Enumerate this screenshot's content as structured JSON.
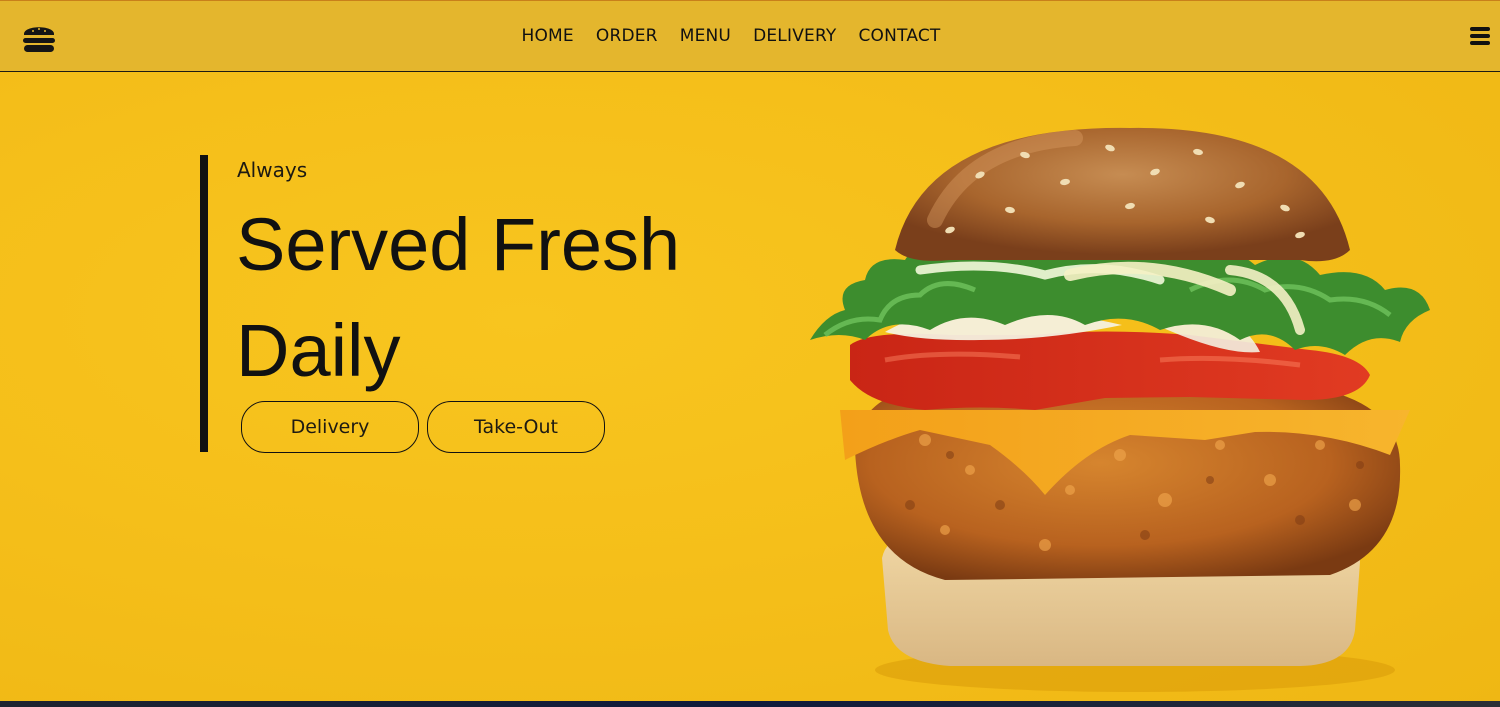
{
  "header": {
    "logo_icon": "burger-icon",
    "nav": [
      "HOME",
      "ORDER",
      "MENU",
      "DELIVERY",
      "CONTACT"
    ],
    "menu_icon": "hamburger-menu-icon"
  },
  "hero": {
    "kicker": "Always",
    "headline_line1": "Served Fresh",
    "headline_line2": "Daily",
    "buttons": {
      "delivery": "Delivery",
      "takeout": "Take-Out"
    },
    "image_icon": "crispy-chicken-burger-image"
  },
  "colors": {
    "background": "#f5bf1a",
    "header": "#e4b62d",
    "text": "#111111"
  }
}
